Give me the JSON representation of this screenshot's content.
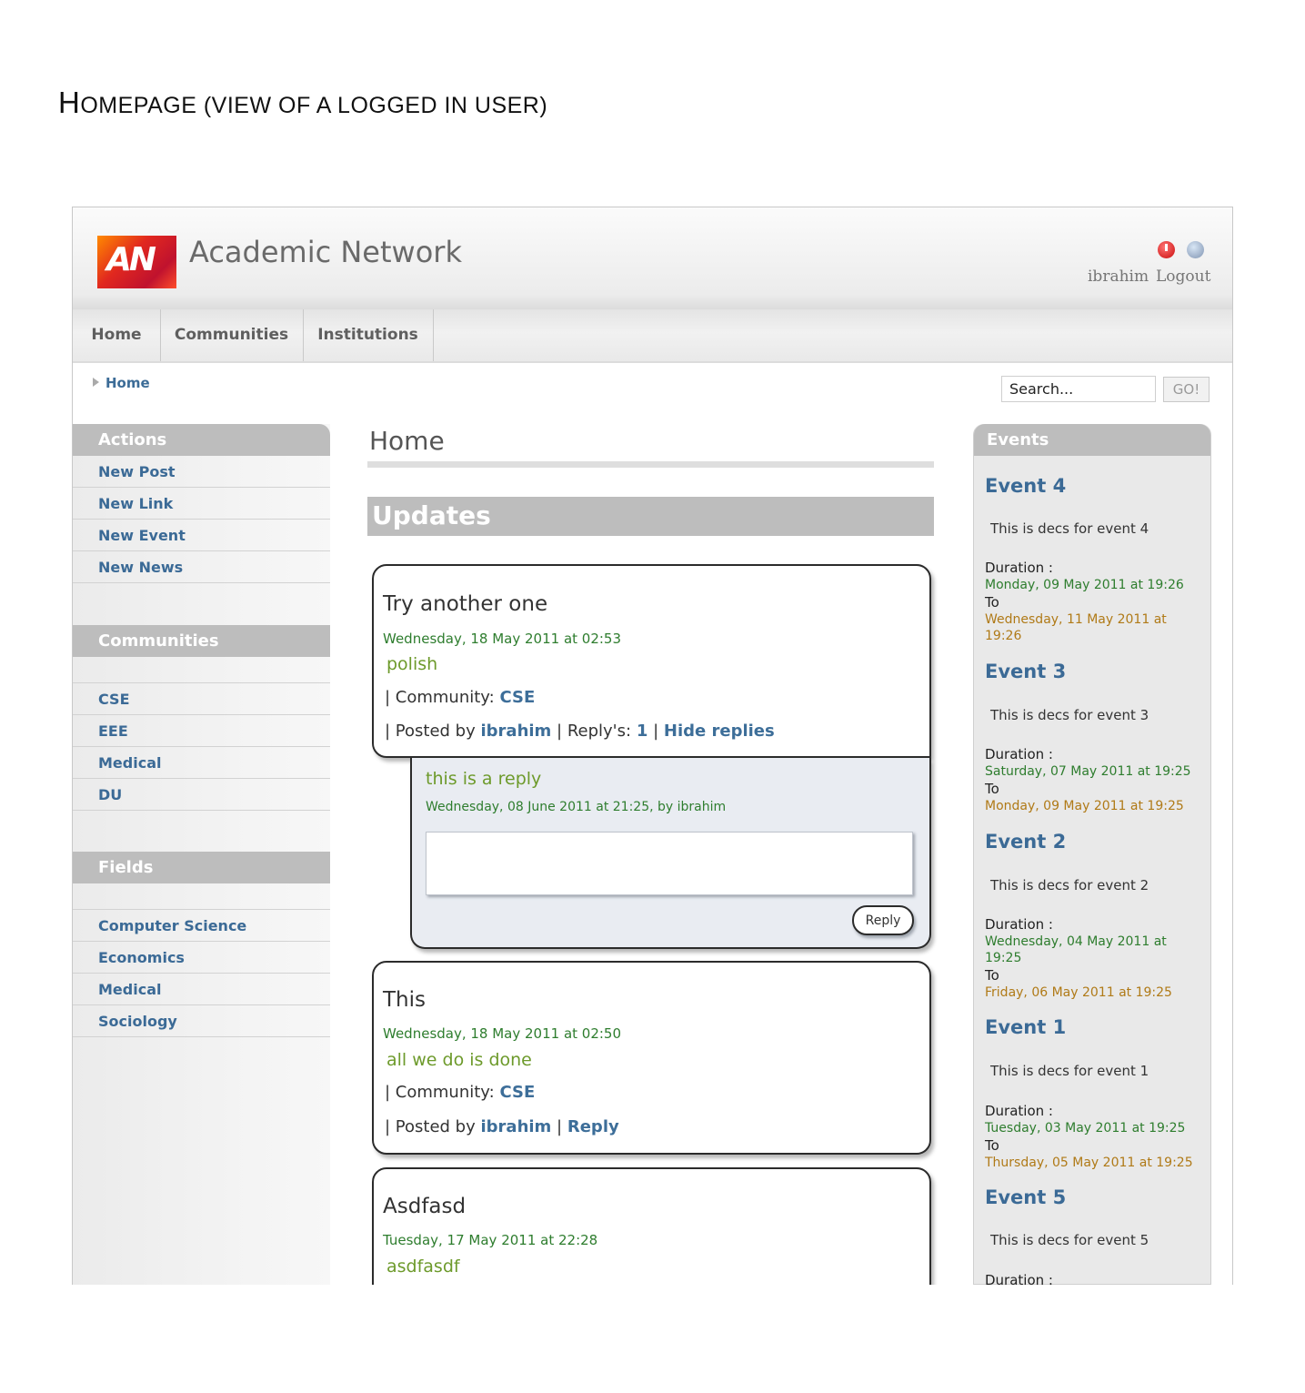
{
  "document": {
    "title_prefix": "H",
    "title_rest": "OMEPAGE (VIEW OF A LOGGED IN USER)"
  },
  "header": {
    "site_title": "Academic Network",
    "logo_text": "AN",
    "user_name": "ibrahim",
    "logout_label": "Logout"
  },
  "nav": {
    "items": [
      "Home",
      "Communities",
      "Institutions"
    ]
  },
  "breadcrumb": {
    "label": "Home"
  },
  "search": {
    "placeholder": "Search...",
    "go_label": "GO!"
  },
  "sidebar": {
    "actions_title": "Actions",
    "actions": [
      "New Post",
      "New Link",
      "New Event",
      "New News"
    ],
    "communities_title": "Communities",
    "communities": [
      "CSE",
      "EEE",
      "Medical",
      "DU"
    ],
    "fields_title": "Fields",
    "fields": [
      "Computer Science",
      "Economics",
      "Medical",
      "Sociology"
    ]
  },
  "main": {
    "heading": "Home",
    "updates_title": "Updates",
    "posts": [
      {
        "title": "Try another one",
        "date": "Wednesday, 18 May 2011 at 02:53",
        "body": "polish",
        "community_label": "| Community:",
        "community": "CSE",
        "posted_label": "| Posted by",
        "author": "ibrahim",
        "replies_label": "| Reply's:",
        "reply_count": "1",
        "sep": "|",
        "hide_replies": "Hide replies",
        "reply": {
          "text": "this is a reply",
          "meta": "Wednesday, 08 June 2011 at 21:25, by ibrahim",
          "button": "Reply"
        }
      },
      {
        "title": "This",
        "date": "Wednesday, 18 May 2011 at 02:50",
        "body": "all we do is done",
        "community_label": "| Community:",
        "community": "CSE",
        "posted_label": "| Posted by",
        "author": "ibrahim",
        "sep": "|",
        "reply_link": "Reply"
      },
      {
        "title": "Asdfasd",
        "date": "Tuesday, 17 May 2011 at 22:28",
        "body": "asdfasdf"
      }
    ]
  },
  "events": {
    "title": "Events",
    "duration_label": "Duration :",
    "to_label": "To",
    "items": [
      {
        "name": "Event 4",
        "desc": "This is decs for event 4",
        "start": "Monday, 09 May 2011 at 19:26",
        "end": "Wednesday, 11 May 2011 at 19:26"
      },
      {
        "name": "Event 3",
        "desc": "This is decs for event 3",
        "start": "Saturday, 07 May 2011 at 19:25",
        "end": "Monday, 09 May 2011 at 19:25"
      },
      {
        "name": "Event 2",
        "desc": "This is decs for event 2",
        "start": "Wednesday, 04 May 2011 at 19:25",
        "end": "Friday, 06 May 2011 at 19:25"
      },
      {
        "name": "Event 1",
        "desc": "This is decs for event 1",
        "start": "Tuesday, 03 May 2011 at 19:25",
        "end": "Thursday, 05 May 2011 at 19:25"
      },
      {
        "name": "Event 5",
        "desc": "This is decs for event 5"
      }
    ]
  }
}
